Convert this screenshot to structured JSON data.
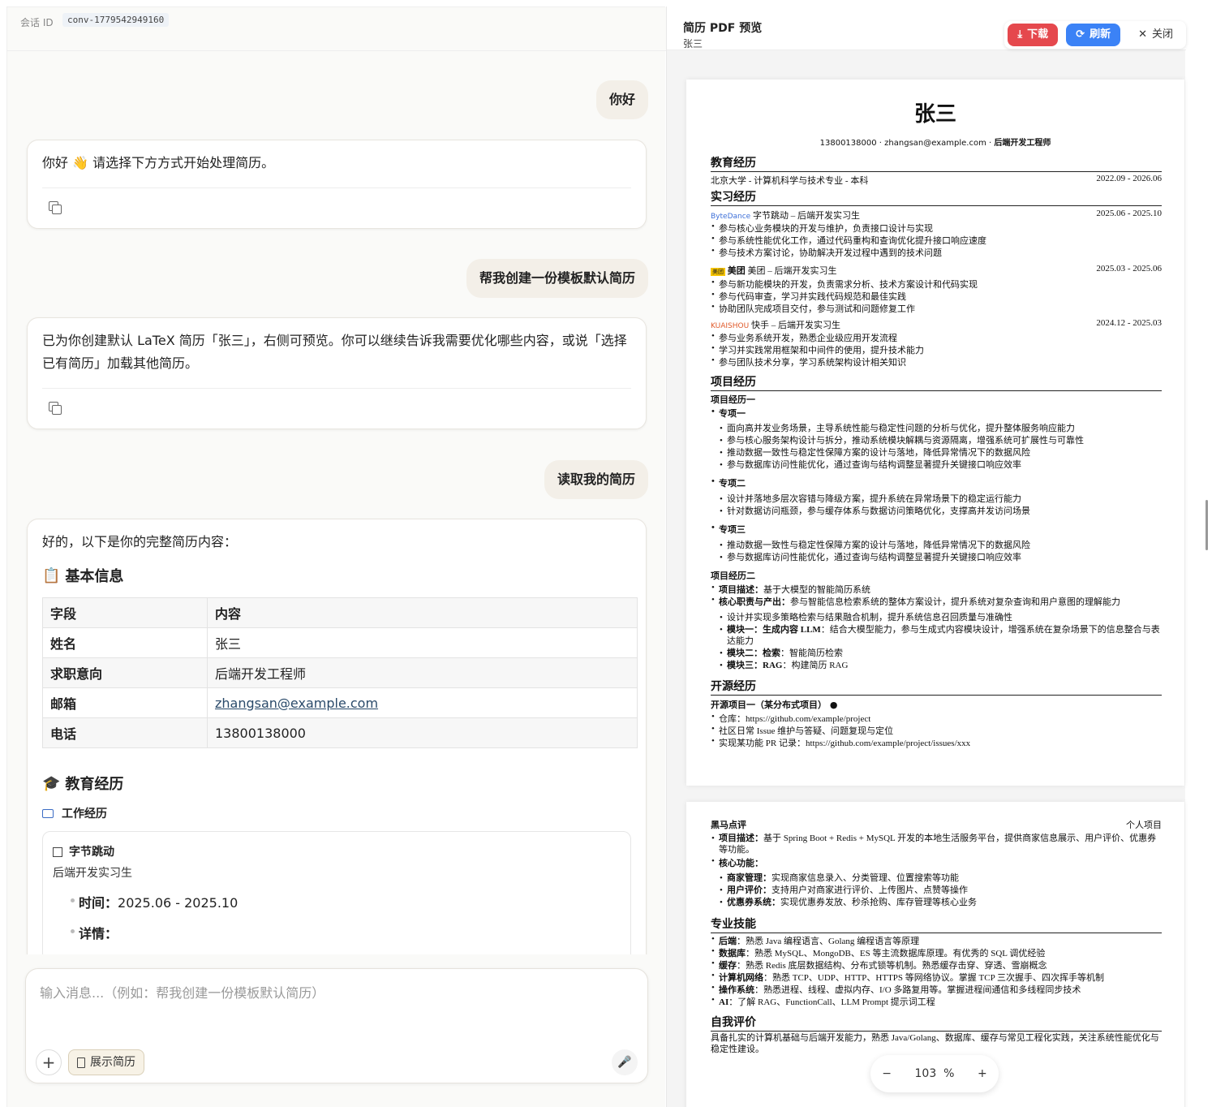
{
  "session": {
    "label": "会话 ID",
    "id": "conv-1779542949160"
  },
  "messages": {
    "u1": "你好",
    "a1": "你好 👋 请选择下方方式开始处理简历。",
    "u2": "帮我创建一份模板默认简历",
    "a2": "已为你创建默认 LaTeX 简历「张三」，右侧可预览。你可以继续告诉我需要优化哪些内容，或说「选择已有简历」加载其他简历。",
    "u3": "读取我的简历",
    "a3_intro": "好的，以下是你的完整简历内容：",
    "a3_basic_heading": "基本信息",
    "a3_table_header": [
      "字段",
      "内容"
    ],
    "a3_table": [
      [
        "姓名",
        "张三"
      ],
      [
        "求职意向",
        "后端开发工程师"
      ],
      [
        "邮箱",
        "zhangsan@example.com"
      ],
      [
        "电话",
        "13800138000"
      ]
    ],
    "a3_edu_heading": "教育经历",
    "a3_work_heading": "工作经历",
    "a3_card": {
      "company": "字节跳动",
      "role": "后端开发实习生",
      "time_label": "时间：",
      "time": "2025.06 - 2025.10",
      "detail_label": "详情："
    }
  },
  "input": {
    "placeholder": "输入消息...（例如：帮我创建一份模板默认简历）",
    "show_resume": "展示简历"
  },
  "preview": {
    "title": "简历 PDF 预览",
    "subtitle": "张三",
    "download": "下载",
    "refresh": "刷新",
    "close": "关闭",
    "zoom": "103",
    "zoom_unit": "%"
  },
  "resume": {
    "name": "张三",
    "phone": "13800138000",
    "email": "zhangsan@example.com",
    "role": "后端开发工程师",
    "sec_edu": "教育经历",
    "edu": "北京大学 - 计算机科学与技术专业 - 本科",
    "edu_time": "2022.09 - 2026.06",
    "sec_intern": "实习经历",
    "bd_logo": "ByteDance",
    "bd_title": "字节跳动 – 后端开发实习生",
    "bd_time": "2025.06 - 2025.10",
    "bd_b1": "参与核心业务模块的开发与维护，负责接口设计与实现",
    "bd_b2": "参与系统性能优化工作，通过代码重构和查询优化提升接口响应速度",
    "bd_b3": "参与技术方案讨论，协助解决开发过程中遇到的技术问题",
    "mt_logo": "美团",
    "mt_logo_text": "美团",
    "mt_title": "美团 – 后端开发实习生",
    "mt_time": "2025.03 - 2025.06",
    "mt_b1": "参与新功能模块的开发，负责需求分析、技术方案设计和代码实现",
    "mt_b2": "参与代码审查，学习并实践代码规范和最佳实践",
    "mt_b3": "协助团队完成项目交付，参与测试和问题修复工作",
    "ks_logo": "KUAISHOU",
    "ks_title": "快手 – 后端开发实习生",
    "ks_time": "2024.12 - 2025.03",
    "ks_b1": "参与业务系统开发，熟悉企业级应用开发流程",
    "ks_b2": "学习并实践常用框架和中间件的使用，提升技术能力",
    "ks_b3": "参与团队技术分享，学习系统架构设计相关知识",
    "sec_proj": "项目经历",
    "proj1": "项目经历一",
    "z1": "专项一",
    "z1_b1": "面向高并发业务场景，主导系统性能与稳定性问题的分析与优化，提升整体服务响应能力",
    "z1_b2": "参与核心服务架构设计与拆分，推动系统模块解耦与资源隔离，增强系统可扩展性与可靠性",
    "z1_b3": "推动数据一致性与稳定性保障方案的设计与落地，降低异常情况下的数据风险",
    "z1_b4": "参与数据库访问性能优化，通过查询与结构调整显著提升关键接口响应效率",
    "z2": "专项二",
    "z2_b1": "设计并落地多层次容错与降级方案，提升系统在异常场景下的稳定运行能力",
    "z2_b2": "针对数据访问瓶颈，参与缓存体系与数据访问策略优化，支撑高并发访问场景",
    "z3": "专项三",
    "z3_b1": "推动数据一致性与稳定性保障方案的设计与落地，降低异常情况下的数据风险",
    "z3_b2": "参与数据库访问性能优化，通过查询与结构调整显著提升关键接口响应效率",
    "proj2": "项目经历二",
    "p2_desc_k": "项目描述：",
    "p2_desc": "基于大模型的智能简历系统",
    "p2_core_k": "核心职责与产出：",
    "p2_core": "参与智能信息检索系统的整体方案设计，提升系统对复杂查询和用户意图的理解能力",
    "p2_b1": "设计并实现多策略检索与结果融合机制，提升系统信息召回质量与准确性",
    "p2_b2_k": "模块一：生成内容 LLM",
    "p2_b2": "：结合大模型能力，参与生成式内容模块设计，增强系统在复杂场景下的信息整合与表达能力",
    "p2_b3_k": "模块二：检索",
    "p2_b3": "：智能简历检索",
    "p2_b4_k": "模块三：RAG",
    "p2_b4": "：构建简历 RAG",
    "sec_os": "开源经历",
    "os1": "开源项目一（某分布式项目）",
    "os_b1": "仓库：https://github.com/example/project",
    "os_b2": "社区日常 Issue 维护与答疑、问题复现与定位",
    "os_b3": "实现某功能 PR 记录：https://github.com/example/project/issues/xxx",
    "hm": "黑马点评",
    "hm_tag": "个人项目",
    "hm_desc_k": "项目描述：",
    "hm_desc": "基于 Spring Boot + Redis + MySQL 开发的本地生活服务平台，提供商家信息展示、用户评价、优惠券等功能。",
    "hm_core_k": "核心功能：",
    "hm_b1_k": "商家管理：",
    "hm_b1": "实现商家信息录入、分类管理、位置搜索等功能",
    "hm_b2_k": "用户评价：",
    "hm_b2": "支持用户对商家进行评价、上传图片、点赞等操作",
    "hm_b3_k": "优惠券系统：",
    "hm_b3": "实现优惠券发放、秒杀抢购、库存管理等核心业务",
    "sec_skill": "专业技能",
    "sk1_k": "后端",
    "sk1": "：熟悉 Java 编程语言、Golang 编程语言等原理",
    "sk2_k": "数据库",
    "sk2": "：熟悉 MySQL、MongoDB、ES 等主流数据库原理。有优秀的 SQL 调优经验",
    "sk3_k": "缓存",
    "sk3": "：熟悉 Redis 底层数据结构、分布式锁等机制。熟悉缓存击穿、穿透、雪崩概念",
    "sk4_k": "计算机网络",
    "sk4": "：熟悉 TCP、UDP、HTTP、HTTPS 等网络协议。掌握 TCP 三次握手、四次挥手等机制",
    "sk5_k": "操作系统",
    "sk5": "：熟悉进程、线程、虚拟内存、I/O 多路复用等。掌握进程间通信和多线程同步技术",
    "sk6_k": "AI",
    "sk6": "：了解 RAG、FunctionCall、LLM Prompt 提示词工程",
    "sec_self": "自我评价",
    "self": "具备扎实的计算机基础与后端开发能力，熟悉 Java/Golang、数据库、缓存与常见工程化实践，关注系统性能优化与稳定性建设。"
  }
}
